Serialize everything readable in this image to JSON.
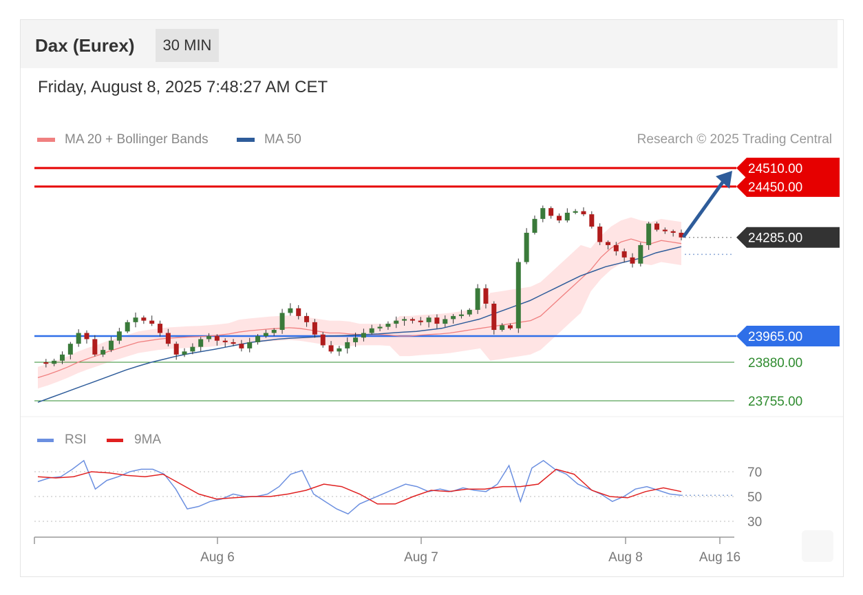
{
  "header": {
    "title": "Dax (Eurex)",
    "timeframe": "30 MIN"
  },
  "timestamp": "Friday, August 8, 2025 7:48:27 AM CET",
  "legend": {
    "ma20": {
      "label": "MA 20 + Bollinger Bands",
      "color": "#f08080"
    },
    "ma50": {
      "label": "MA 50",
      "color": "#2e5c9a"
    }
  },
  "credit": "Research © 2025 Trading Central",
  "rsi_legend": {
    "rsi": {
      "label": "RSI",
      "color": "#6b8fe0"
    },
    "ma9": {
      "label": "9MA",
      "color": "#e02020"
    }
  },
  "chart_data": [
    {
      "type": "candlestick",
      "ylim": [
        23700,
        24560
      ],
      "x_ticks": [
        "Aug 6",
        "Aug 7",
        "Aug 8",
        "Aug 16"
      ],
      "levels": [
        {
          "label": "24510.00",
          "value": 24510,
          "kind": "resistance",
          "color": "#e60000"
        },
        {
          "label": "24450.00",
          "value": 24450,
          "kind": "resistance",
          "color": "#e60000"
        },
        {
          "label": "24285.00",
          "value": 24285,
          "kind": "last",
          "color": "#333333"
        },
        {
          "label": "23965.00",
          "value": 23965,
          "kind": "pivot",
          "color": "#2f6fe8"
        },
        {
          "label": "23880.00",
          "value": 23880,
          "kind": "support",
          "color": "#2e8b2e"
        },
        {
          "label": "23755.00",
          "value": 23755,
          "kind": "support",
          "color": "#2e8b2e"
        }
      ],
      "price_path": [
        23880,
        23875,
        23885,
        23905,
        23940,
        23975,
        23955,
        23905,
        23920,
        23950,
        23980,
        24010,
        24025,
        24015,
        24005,
        23975,
        23940,
        23905,
        23915,
        23930,
        23955,
        23965,
        23950,
        23945,
        23940,
        23925,
        23945,
        23965,
        23975,
        23985,
        24040,
        24055,
        24030,
        24010,
        23970,
        23935,
        23915,
        23925,
        23945,
        23960,
        23975,
        23990,
        23995,
        24005,
        24015,
        24020,
        24015,
        24010,
        24025,
        24005,
        24020,
        24030,
        24035,
        24050,
        24120,
        24070,
        23985,
        24000,
        23990,
        24205,
        24300,
        24345,
        24380,
        24355,
        24340,
        24365,
        24370,
        24360,
        24320,
        24270,
        24260,
        24240,
        24220,
        24200,
        24260,
        24330,
        24310,
        24305,
        24300,
        24285
      ],
      "ma20": [
        23830,
        23840,
        23852,
        23865,
        23880,
        23892,
        23903,
        23915,
        23925,
        23935,
        23945,
        23950,
        23955,
        23958,
        23960,
        23962,
        23963,
        23965,
        23968,
        23972,
        23978,
        23982,
        23985,
        23988,
        23990,
        23992,
        23990,
        23985,
        23980,
        23975,
        23975,
        23972,
        23970,
        23970,
        23970,
        23968,
        23965,
        23965,
        23968,
        23970,
        23972,
        23975,
        23980,
        23985,
        23990,
        23995,
        24000,
        24005,
        24010,
        24015,
        24030,
        24060,
        24090,
        24120,
        24150,
        24180,
        24220,
        24250,
        24270,
        24280,
        24270,
        24265,
        24275,
        24270,
        24265
      ],
      "ma50": [
        23750,
        23765,
        23780,
        23795,
        23810,
        23825,
        23840,
        23855,
        23868,
        23880,
        23890,
        23900,
        23908,
        23915,
        23922,
        23930,
        23938,
        23945,
        23950,
        23955,
        23958,
        23960,
        23962,
        23965,
        23966,
        23968,
        23970,
        23972,
        23975,
        23978,
        23980,
        23985,
        23990,
        24000,
        24010,
        24020,
        24035,
        24050,
        24065,
        24080,
        24100,
        24120,
        24140,
        24160,
        24175,
        24190,
        24200,
        24210,
        24220,
        24235,
        24245,
        24255
      ],
      "forecast_target": 24510
    },
    {
      "type": "line",
      "ylim": [
        20,
        90
      ],
      "y_ticks": [
        "70",
        "50",
        "30"
      ],
      "series": [
        {
          "name": "RSI",
          "color": "#6b8fe0",
          "values": [
            62,
            65,
            66,
            72,
            79,
            56,
            63,
            66,
            70,
            72,
            72,
            68,
            56,
            40,
            42,
            46,
            48,
            52,
            50,
            50,
            52,
            58,
            68,
            71,
            52,
            46,
            40,
            36,
            44,
            48,
            52,
            56,
            60,
            58,
            54,
            56,
            54,
            57,
            55,
            54,
            60,
            75,
            46,
            73,
            79,
            72,
            68,
            60,
            56,
            52,
            46,
            50,
            56,
            58,
            55,
            52,
            51
          ]
        },
        {
          "name": "9MA",
          "color": "#e02020",
          "values": [
            66,
            65,
            66,
            70,
            69,
            67,
            66,
            68,
            60,
            52,
            48,
            49,
            50,
            50,
            52,
            55,
            60,
            58,
            52,
            44,
            44,
            50,
            55,
            54,
            56,
            56,
            58,
            58,
            60,
            72,
            68,
            55,
            50,
            49,
            54,
            57,
            54
          ]
        }
      ]
    }
  ]
}
